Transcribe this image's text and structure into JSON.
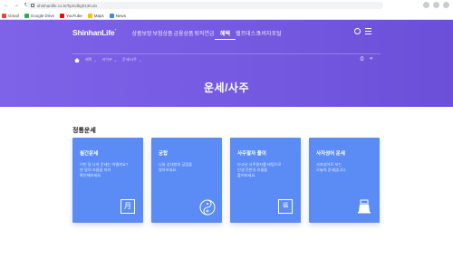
{
  "browser": {
    "url": "shinhanlife.co.kr/hp/cdhg0130.do",
    "bookmarks": [
      {
        "label": "Gmail",
        "color": "#ea4335"
      },
      {
        "label": "Google Drive",
        "color": "#34a853"
      },
      {
        "label": "YouTube",
        "color": "#ff0000"
      },
      {
        "label": "Maps",
        "color": "#fbbc04"
      },
      {
        "label": "News",
        "color": "#4285f4"
      }
    ]
  },
  "header": {
    "logo": "ShinhanLife",
    "menu": [
      "상품보장",
      "보험상품",
      "금융상품",
      "퇴직연금",
      "혜택",
      "헬프데스크",
      "소비자포털"
    ],
    "active_menu": "혜택",
    "breadcrumb": [
      "혜택",
      "라이프",
      "운세/사주"
    ],
    "page_title": "운세/사주"
  },
  "main": {
    "section_title": "정통운세",
    "cards": [
      {
        "title": "월간운세",
        "desc": [
          "이번 달 나의 운세는 어떨까요?",
          "한 달의 흐름을 미리",
          "확인해보세요."
        ],
        "icon_name": "calendar-moon-icon",
        "icon_char": "月"
      },
      {
        "title": "궁합",
        "desc": [
          "나와 상대방의 궁합을",
          "알아보세요."
        ],
        "icon_name": "yin-yang-icon",
        "icon_char": ""
      },
      {
        "title": "사주팔자 풀이",
        "desc": [
          "타고난 사주팔자를 바탕으로",
          "인생 전반의 흐름을",
          "풀어보세요."
        ],
        "icon_name": "fortune-chart-icon",
        "icon_char": "福"
      },
      {
        "title": "사자성어 운세",
        "desc": [
          "사자성어로 보는",
          "오늘의 운세입니다."
        ],
        "icon_name": "ink-brush-icon",
        "icon_char": ""
      }
    ]
  }
}
